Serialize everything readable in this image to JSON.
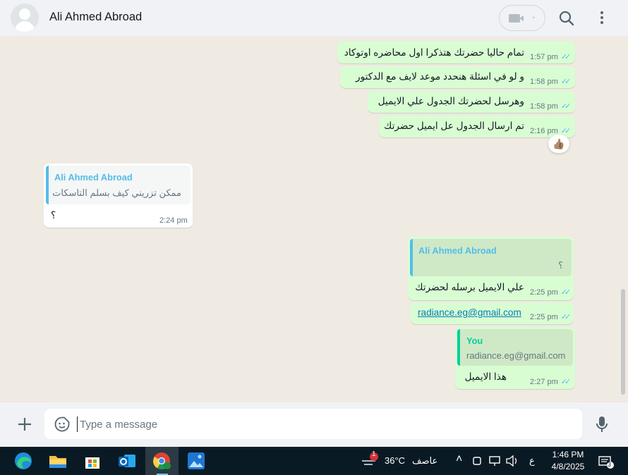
{
  "header": {
    "contact_name": "Ali Ahmed Abroad",
    "icons": [
      "avatar-placeholder",
      "video-call-icon",
      "chevron-down-icon",
      "search-icon",
      "more-vertical-icon"
    ]
  },
  "messages": [
    {
      "direction": "out",
      "text": "تمام حاليا حضرتك هتذكرا اول محاضره اوتوكاد",
      "time": "1:57 pm",
      "status": "read"
    },
    {
      "direction": "out",
      "text": "و لو في اسئلة هنحدد موعد لايف مع الدكتور",
      "time": "1:58 pm",
      "status": "read"
    },
    {
      "direction": "out",
      "text": "وهرسل لحضرتك الجدول علي الايميل",
      "time": "1:58 pm",
      "status": "read"
    },
    {
      "direction": "out",
      "text": "تم ارسال الجدول عل ايميل حضرتك",
      "time": "2:16 pm",
      "status": "read",
      "reaction": "👍🏽"
    },
    {
      "direction": "in",
      "quote_name": "Ali Ahmed Abroad",
      "quote_text": "ممكن تزريني كيف بسلم التاسكات",
      "text": "؟",
      "time": "2:24 pm"
    },
    {
      "direction": "out",
      "quote_name": "Ali Ahmed Abroad",
      "quote_text": "؟",
      "text": "علي الايميل برسله لحضرتك",
      "time": "2:25 pm",
      "status": "read"
    },
    {
      "direction": "out",
      "text": "radiance.eg@gmail.com",
      "time": "2:25 pm",
      "status": "read",
      "is_link": true
    },
    {
      "direction": "out",
      "quote_name": "You",
      "quote_text": "radiance.eg@gmail.com",
      "text": "هذا الايميل",
      "time": "2:27 pm",
      "status": "read"
    }
  ],
  "composer": {
    "placeholder": "Type a message",
    "icons": [
      "plus-icon",
      "sticker-icon",
      "microphone-icon"
    ]
  },
  "taskbar": {
    "apps": [
      "edge-icon",
      "file-explorer-icon",
      "microsoft-store-icon",
      "outlook-icon",
      "chrome-icon",
      "photos-icon"
    ],
    "weather_badge": "1",
    "temperature": "36°C",
    "weather_condition": "عاصف",
    "language": "ع",
    "time": "1:46 PM",
    "date": "4/8/2025",
    "notification_count": "3"
  },
  "colors": {
    "outgoing_bubble": "#d9fdd3",
    "incoming_bubble": "#ffffff",
    "chat_background": "#efeae2",
    "read_ticks": "#53bdeb",
    "quote_in_name": "#53bdeb",
    "quote_you_name": "#06cf9c"
  }
}
